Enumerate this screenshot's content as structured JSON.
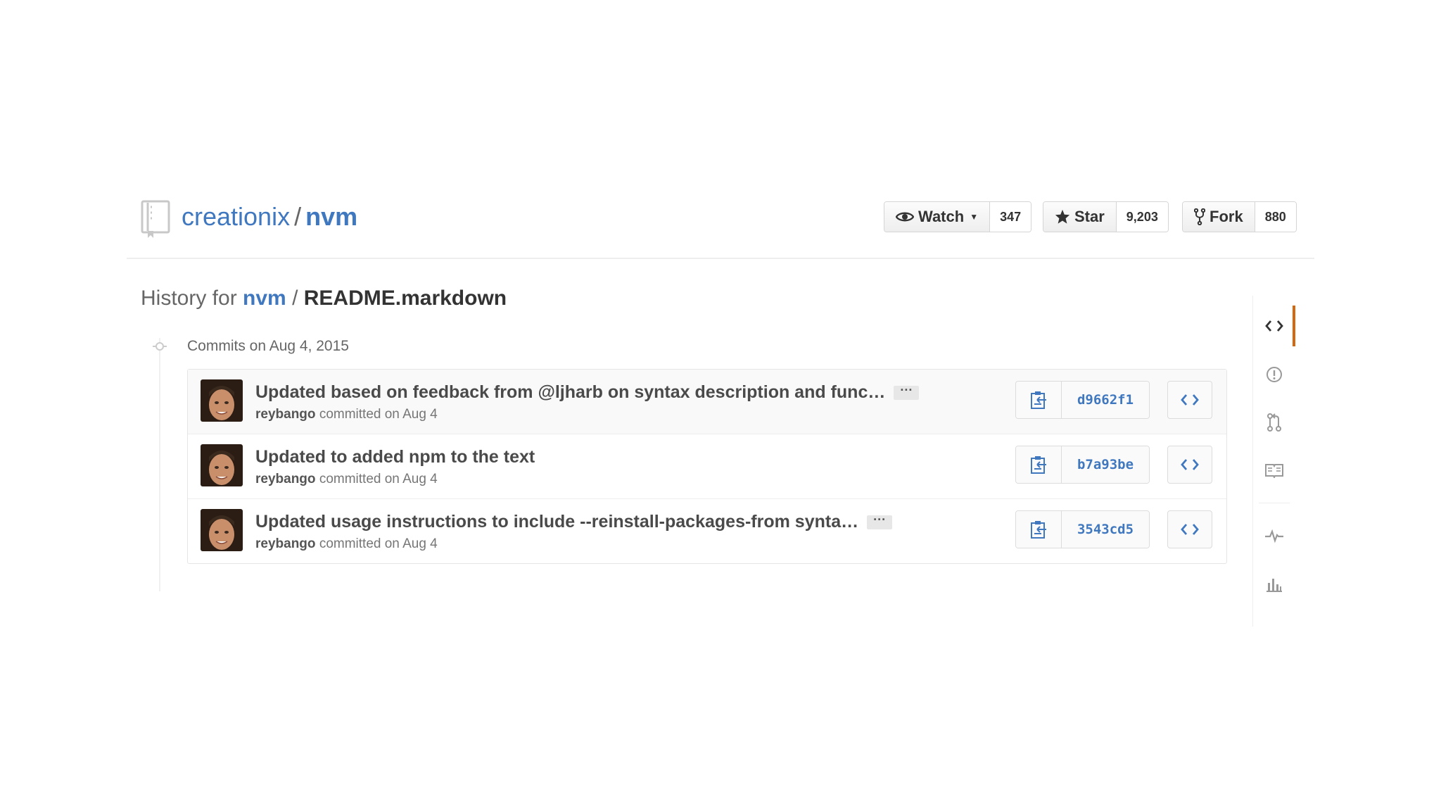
{
  "repo": {
    "owner": "creationix",
    "separator": "/",
    "name": "nvm"
  },
  "actions": {
    "watch": {
      "label": "Watch",
      "count": "347"
    },
    "star": {
      "label": "Star",
      "count": "9,203"
    },
    "fork": {
      "label": "Fork",
      "count": "880"
    }
  },
  "history": {
    "prefix": "History for",
    "repo_link": "nvm",
    "separator": "/",
    "file": "README.markdown"
  },
  "commit_group": {
    "date_label": "Commits on Aug 4, 2015"
  },
  "commits": [
    {
      "message": "Updated based on feedback from @ljharb on syntax description and func…",
      "has_more": true,
      "author": "reybango",
      "meta": "committed on Aug 4",
      "sha": "d9662f1"
    },
    {
      "message": "Updated to added npm to the text",
      "has_more": false,
      "author": "reybango",
      "meta": "committed on Aug 4",
      "sha": "b7a93be"
    },
    {
      "message": "Updated usage instructions to include --reinstall-packages-from synta…",
      "has_more": true,
      "author": "reybango",
      "meta": "committed on Aug 4",
      "sha": "3543cd5"
    }
  ],
  "ui": {
    "ellipsis": "···"
  },
  "side_nav": {
    "items": [
      "code-icon",
      "issues-icon",
      "pull-requests-icon",
      "wiki-icon",
      "pulse-icon",
      "graphs-icon"
    ],
    "active": "code-icon",
    "accent_color": "#d26911"
  },
  "colors": {
    "link": "#4078c0",
    "text": "#333333",
    "muted": "#767676"
  }
}
